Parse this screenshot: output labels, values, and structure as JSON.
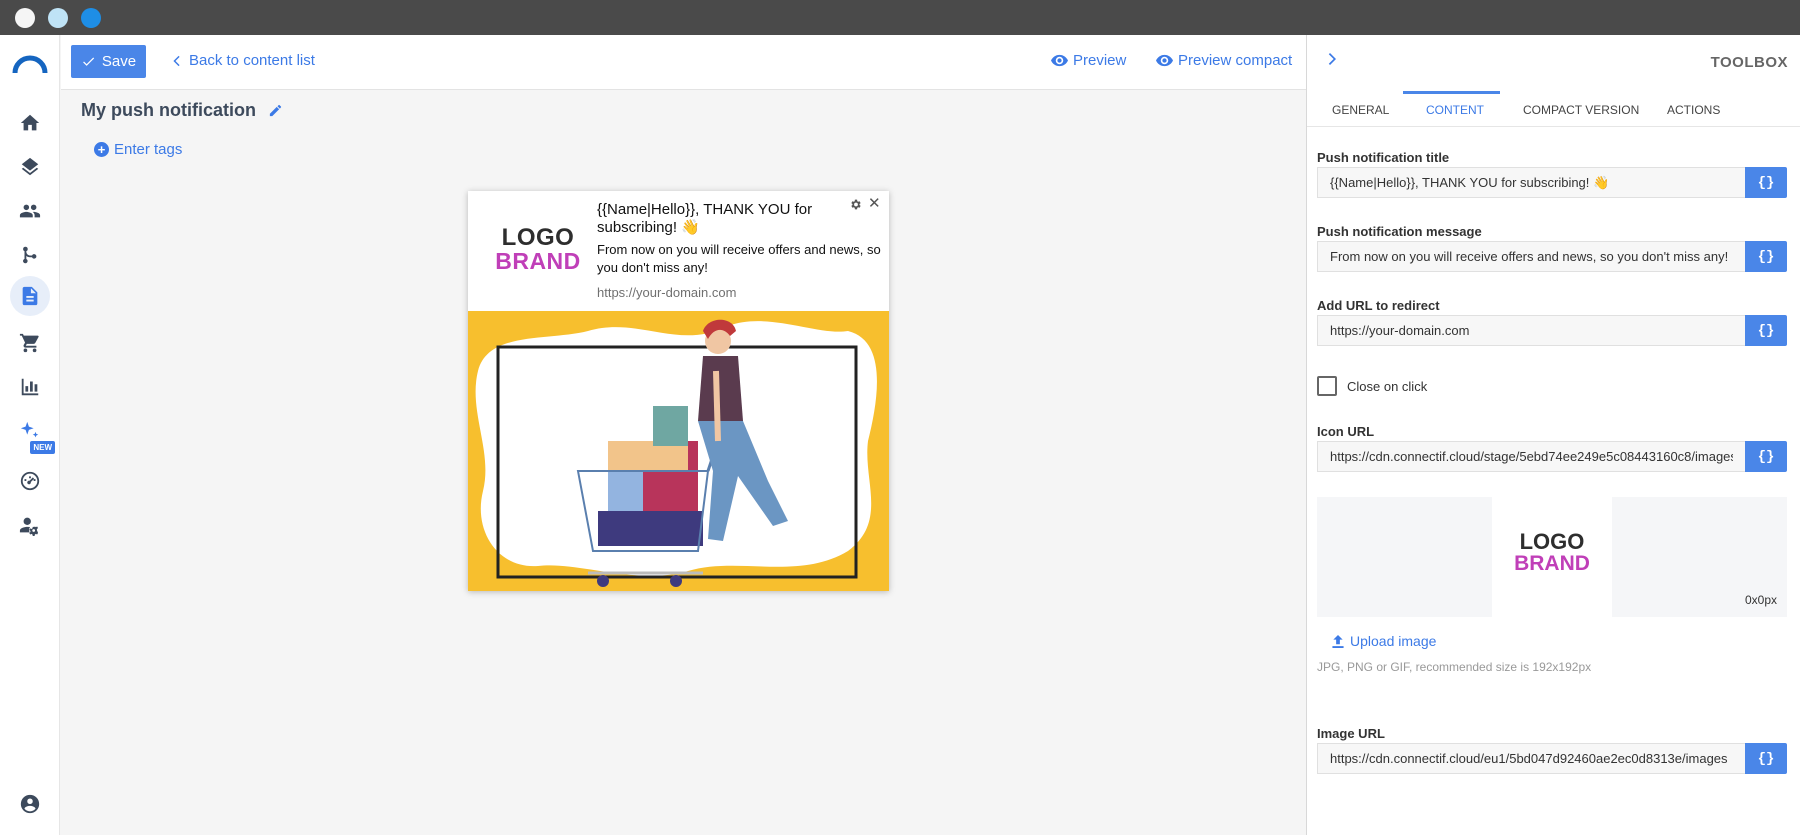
{
  "window": {
    "controls": [
      "close",
      "minimize",
      "maximize"
    ]
  },
  "nav": {
    "items": [
      {
        "name": "home-icon"
      },
      {
        "name": "layers-icon"
      },
      {
        "name": "contacts-icon"
      },
      {
        "name": "workflow-icon"
      },
      {
        "name": "content-icon",
        "active": true
      },
      {
        "name": "cart-icon"
      },
      {
        "name": "reports-icon"
      },
      {
        "name": "ai-sparkle-icon",
        "badge": "NEW"
      },
      {
        "name": "dashboard-icon"
      },
      {
        "name": "user-settings-icon"
      },
      {
        "name": "account-icon"
      }
    ],
    "new_badge": "NEW"
  },
  "toolbar": {
    "save_label": "Save",
    "back_label": "Back to content list",
    "preview_label": "Preview",
    "preview_compact_label": "Preview compact"
  },
  "main": {
    "title": "My push notification",
    "tags_label": "Enter tags"
  },
  "preview_card": {
    "logo_line1": "LOGO",
    "logo_line2": "BRAND",
    "title": "{{Name|Hello}}, THANK YOU for subscribing! 👋",
    "message": "From now on you will receive offers and news, so you don't miss any!",
    "url": "https://your-domain.com",
    "close_glyph": "✕"
  },
  "panel": {
    "header": "TOOLBOX",
    "tabs": [
      {
        "label": "GENERAL"
      },
      {
        "label": "CONTENT",
        "active": true
      },
      {
        "label": "COMPACT VERSION"
      },
      {
        "label": "ACTIONS"
      }
    ],
    "var_button": "{}",
    "title_label": "Push notification title",
    "title_value": "{{Name|Hello}}, THANK YOU for subscribing! 👋",
    "message_label": "Push notification message",
    "message_value": "From now on you will receive offers and news, so you don't miss any!",
    "url_label": "Add URL to redirect",
    "url_value": "https://your-domain.com",
    "close_on_click_label": "Close on click",
    "close_on_click": false,
    "icon_url_label": "Icon URL",
    "icon_url_value": "https://cdn.connectif.cloud/stage/5ebd74ee249e5c08443160c8/images",
    "icon_logo_line1": "LOGO",
    "icon_logo_line2": "BRAND",
    "icon_dims": "0x0px",
    "upload_label": "Upload image",
    "upload_hint": "JPG, PNG or GIF, recommended size is 192x192px",
    "image_url_label": "Image URL",
    "image_url_value": "https://cdn.connectif.cloud/eu1/5bd047d92460ae2ec0d8313e/images"
  },
  "colors": {
    "accent": "#4a86e8",
    "link": "#3c7ae6",
    "brand_magenta": "#c03fb8",
    "illustration_yellow": "#f7bf2e"
  }
}
